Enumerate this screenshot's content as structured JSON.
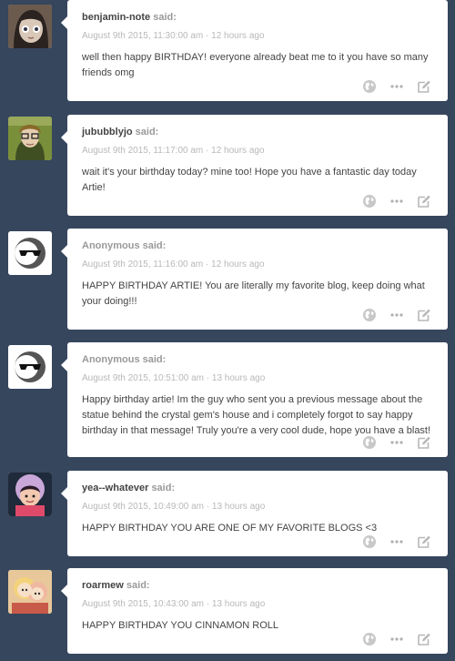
{
  "said_label": "said:",
  "icons": {
    "reblog": "globe-icon",
    "more": "ellipsis-icon",
    "edit": "edit-icon"
  },
  "posts": [
    {
      "asker": "benjamin-note",
      "anonymous": false,
      "date": "August 9th 2015, 11:30:00 am",
      "ago": "12 hours ago",
      "text": "well then happy BIRTHDAY! everyone already beat me to it you have so many friends omg"
    },
    {
      "asker": "jububblyjo",
      "anonymous": false,
      "date": "August 9th 2015, 11:17:00 am",
      "ago": "12 hours ago",
      "text": "wait it's your birthday today? mine too! Hope you have a fantastic day today Artie!"
    },
    {
      "asker": "Anonymous",
      "anonymous": true,
      "date": "August 9th 2015, 11:16:00 am",
      "ago": "12 hours ago",
      "text": "HAPPY BIRTHDAY ARTIE! You are literally my favorite blog, keep doing what your doing!!!"
    },
    {
      "asker": "Anonymous",
      "anonymous": true,
      "date": "August 9th 2015, 10:51:00 am",
      "ago": "13 hours ago",
      "text": "Happy birthday artie! Im the guy who sent you a previous message about the statue behind the crystal gem's house and i completely forgot to say happy birthday in that message! Truly you're a very cool dude, hope you have a blast!"
    },
    {
      "asker": "yea--whatever",
      "anonymous": false,
      "date": "August 9th 2015, 10:49:00 am",
      "ago": "13 hours ago",
      "text": "HAPPY BIRTHDAY YOU ARE ONE OF MY FAVORITE BLOGS <3"
    },
    {
      "asker": "roarmew",
      "anonymous": false,
      "date": "August 9th 2015, 10:43:00 am",
      "ago": "13 hours ago",
      "text": "HAPPY BIRTHDAY YOU CINNAMON ROLL"
    }
  ]
}
